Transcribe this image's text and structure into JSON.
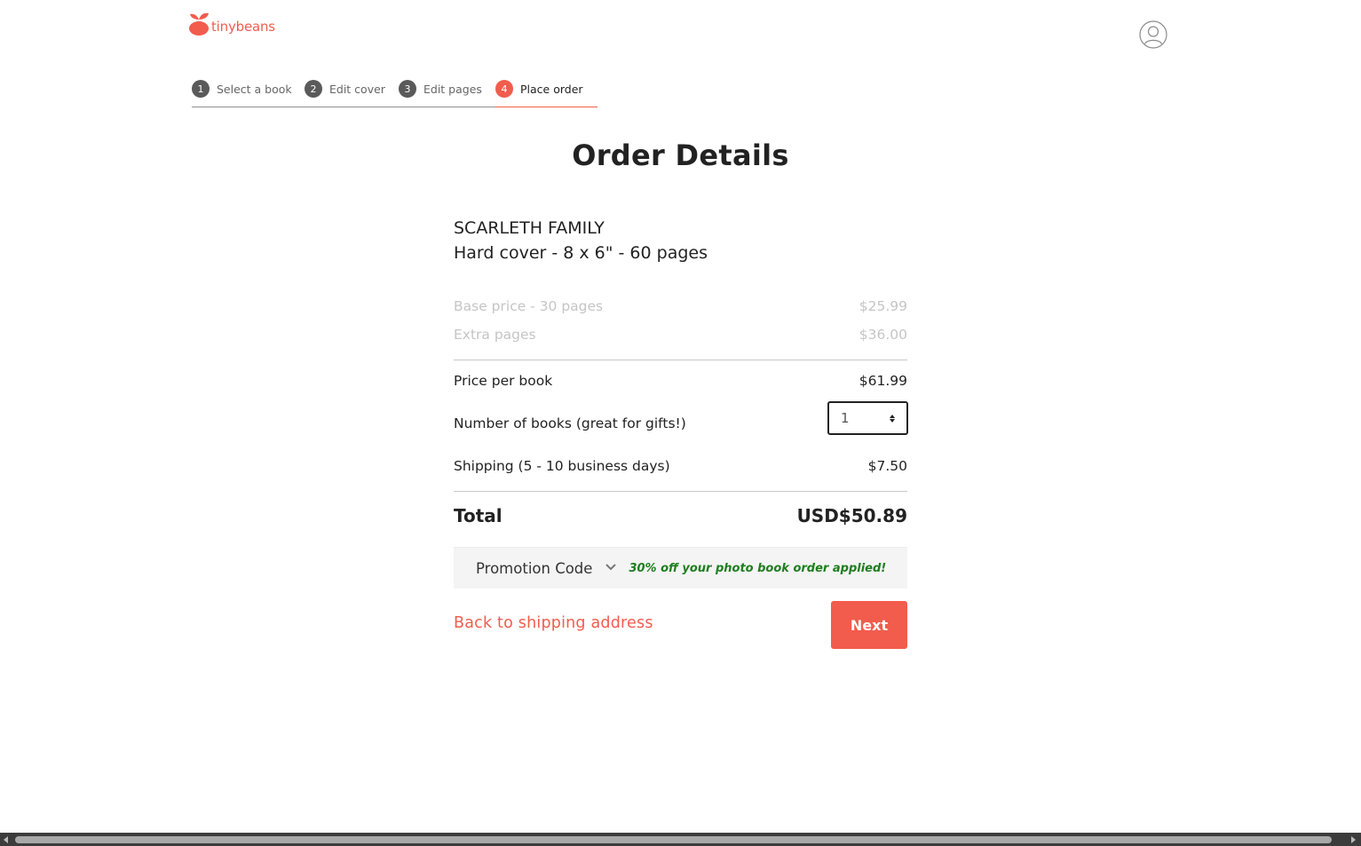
{
  "brand": {
    "name": "tinybeans",
    "color": "#f25c4d"
  },
  "header": {
    "avatar_icon": "user-avatar-icon"
  },
  "steps": [
    {
      "num": "1",
      "label": "Select a book",
      "active": false
    },
    {
      "num": "2",
      "label": "Edit cover",
      "active": false
    },
    {
      "num": "3",
      "label": "Edit pages",
      "active": false
    },
    {
      "num": "4",
      "label": "Place order",
      "active": true
    }
  ],
  "page": {
    "title": "Order Details"
  },
  "product": {
    "name": "SCARLETH FAMILY",
    "spec": "Hard cover - 8 x 6\" - 60 pages"
  },
  "pricing": {
    "base_label": "Base price - 30 pages",
    "base_value": "$25.99",
    "extra_label": "Extra pages",
    "extra_value": "$36.00",
    "per_book_label": "Price per book",
    "per_book_value": "$61.99",
    "quantity_label": "Number of books (great for gifts!)",
    "quantity_value": "1",
    "shipping_label": "Shipping (5 - 10 business days)",
    "shipping_value": "$7.50",
    "total_label": "Total",
    "total_value": "USD$50.89"
  },
  "promo": {
    "label": "Promotion Code",
    "message": "30% off your photo book order applied!",
    "message_color": "#1e7e1e"
  },
  "actions": {
    "back_label": "Back to shipping address",
    "next_label": "Next"
  }
}
